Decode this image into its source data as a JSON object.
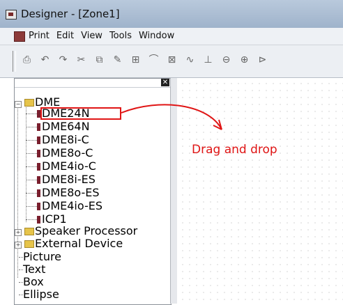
{
  "window": {
    "title": "Designer - [Zone1]"
  },
  "menu": {
    "items": [
      "Print",
      "Edit",
      "View",
      "Tools",
      "Window"
    ]
  },
  "tree": {
    "root": "DME",
    "devices": [
      "DME24N",
      "DME64N",
      "DME8i-C",
      "DME8o-C",
      "DME4io-C",
      "DME8i-ES",
      "DME8o-ES",
      "DME4io-ES",
      "ICP1"
    ],
    "folders": [
      "Speaker Processor",
      "External Device"
    ],
    "shapes": [
      "Picture",
      "Text",
      "Box",
      "Ellipse"
    ]
  },
  "annotation": {
    "text": "Drag and drop"
  },
  "colors": {
    "annotation": "#e01515",
    "chip": "#7a1f2e",
    "folder": "#e6c44a"
  }
}
